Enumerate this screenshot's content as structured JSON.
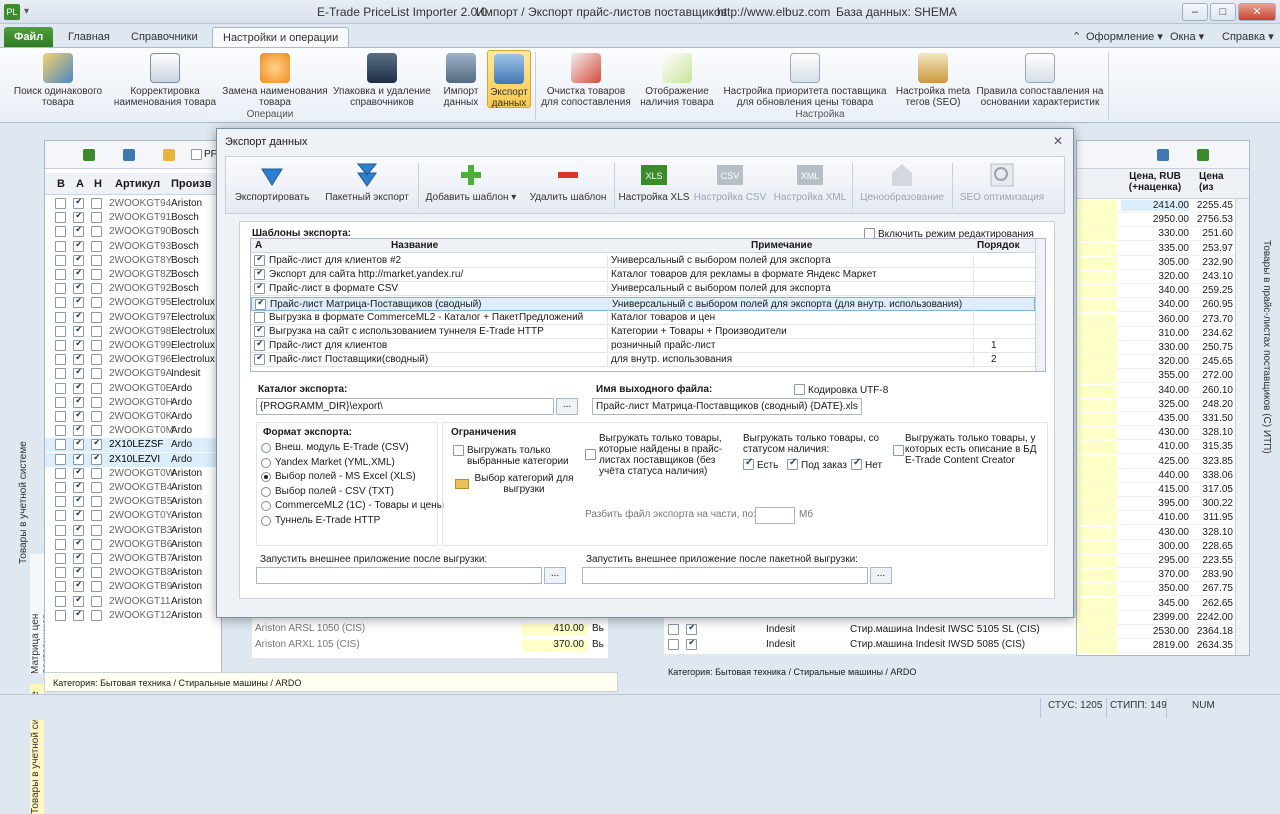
{
  "window": {
    "title": "E-Trade PriceList Importer 2.0.0",
    "subtitle": "Импорт / Экспорт прайс-листов поставщиков",
    "url": "http://www.elbuz.com",
    "db": "База данных: SHEMA"
  },
  "tabs": [
    "Файл",
    "Главная",
    "Справочники",
    "Настройки и операции"
  ],
  "right_menu": [
    "Оформление",
    "Окна",
    "Справка"
  ],
  "ribbon": {
    "buttons": [
      {
        "label": "Поиск одинакового товара"
      },
      {
        "label": "Корректировка наименования товара"
      },
      {
        "label": "Замена наименования товара"
      },
      {
        "label": "Упаковка и удаление справочников"
      },
      {
        "label": "Импорт данных"
      },
      {
        "label": "Экспорт данных"
      },
      {
        "label": "Очистка товаров для сопоставления"
      },
      {
        "label": "Отображение наличия товара"
      },
      {
        "label": "Настройка приоритета поставщика для обновления цены товара"
      },
      {
        "label": "Настройка meta тегов (SEO)"
      },
      {
        "label": "Правила сопоставления на основании характеристик"
      }
    ],
    "groups": [
      "Операции",
      "Настройка"
    ]
  },
  "left_grid": {
    "headers": [
      "В",
      "А",
      "Н",
      "Артикул",
      "Произв"
    ],
    "rows": [
      {
        "art": "2WOOKGT94",
        "brand": "Ariston",
        "a": true,
        "h": false
      },
      {
        "art": "2WOOKGT91",
        "brand": "Bosch",
        "a": true,
        "h": false
      },
      {
        "art": "2WOOKGT90",
        "brand": "Bosch",
        "a": true,
        "h": false
      },
      {
        "art": "2WOOKGT93",
        "brand": "Bosch",
        "a": true,
        "h": false
      },
      {
        "art": "2WOOKGT8Y",
        "brand": "Bosch",
        "a": true,
        "h": false
      },
      {
        "art": "2WOOKGT8Z",
        "brand": "Bosch",
        "a": true,
        "h": false
      },
      {
        "art": "2WOOKGT92",
        "brand": "Bosch",
        "a": true,
        "h": false
      },
      {
        "art": "2WOOKGT95",
        "brand": "Electrolux",
        "a": true,
        "h": false
      },
      {
        "art": "2WOOKGT97",
        "brand": "Electrolux",
        "a": true,
        "h": false
      },
      {
        "art": "2WOOKGT98",
        "brand": "Electrolux",
        "a": true,
        "h": false
      },
      {
        "art": "2WOOKGT99",
        "brand": "Electrolux",
        "a": true,
        "h": false
      },
      {
        "art": "2WOOKGT96",
        "brand": "Electrolux",
        "a": true,
        "h": false
      },
      {
        "art": "2WOOKGT9A",
        "brand": "Indesit",
        "a": true,
        "h": false
      },
      {
        "art": "2WOOKGT0E",
        "brand": "Ardo",
        "a": true,
        "h": false
      },
      {
        "art": "2WOOKGT0H",
        "brand": "Ardo",
        "a": true,
        "h": false
      },
      {
        "art": "2WOOKGT0K",
        "brand": "Ardo",
        "a": true,
        "h": false
      },
      {
        "art": "2WOOKGT0M",
        "brand": "Ardo",
        "a": true,
        "h": false
      },
      {
        "art": "2X10LEZSF",
        "brand": "Ardo",
        "a": true,
        "h": true
      },
      {
        "art": "2X10LEZVI",
        "brand": "Ardo",
        "a": true,
        "h": true
      },
      {
        "art": "2WOOKGT0W",
        "brand": "Ariston",
        "a": true,
        "h": false
      },
      {
        "art": "2WOOKGTB4",
        "brand": "Ariston",
        "a": true,
        "h": false
      },
      {
        "art": "2WOOKGTB5",
        "brand": "Ariston",
        "a": true,
        "h": false
      },
      {
        "art": "2WOOKGT0Y",
        "brand": "Ariston",
        "a": true,
        "h": false
      },
      {
        "art": "2WOOKGTB3",
        "brand": "Ariston",
        "a": true,
        "h": false
      },
      {
        "art": "2WOOKGTB6",
        "brand": "Ariston",
        "a": true,
        "h": false
      },
      {
        "art": "2WOOKGTB7",
        "brand": "Ariston",
        "a": true,
        "h": false
      },
      {
        "art": "2WOOKGTB8",
        "brand": "Ariston",
        "a": true,
        "h": false
      },
      {
        "art": "2WOOKGTB9",
        "brand": "Ariston",
        "a": true,
        "h": false
      },
      {
        "art": "2WOOKGT11",
        "brand": "Ariston",
        "a": true,
        "h": false
      },
      {
        "art": "2WOOKGT12",
        "brand": "Ariston",
        "a": true,
        "h": false
      }
    ],
    "peek_rows": [
      {
        "name": "Ariston ARSL 1050 (CIS)",
        "price": "410.00",
        "extra": "Вь"
      },
      {
        "name": "Ariston ARXL 105 (CIS)",
        "price": "370.00",
        "extra": "Вь"
      }
    ],
    "category": "Категория: Бытовая техника / Стиральные машины / ARDO",
    "vtabs": [
      "Товары в учетной системе",
      "Матрица цен поставщиков",
      "Товары в учетной системе"
    ],
    "pr_label": "PF"
  },
  "right_grid": {
    "headers": [
      "Цена, RUB (+наценка)",
      "Цена (из"
    ],
    "rows": [
      [
        "2414.00",
        "2255.45"
      ],
      [
        "2950.00",
        "2756.53"
      ],
      [
        "330.00",
        "251.60"
      ],
      [
        "335.00",
        "253.97"
      ],
      [
        "305.00",
        "232.90"
      ],
      [
        "320.00",
        "243.10"
      ],
      [
        "340.00",
        "259.25"
      ],
      [
        "340.00",
        "260.95"
      ],
      [
        "360.00",
        "273.70"
      ],
      [
        "310.00",
        "234.62"
      ],
      [
        "330.00",
        "250.75"
      ],
      [
        "320.00",
        "245.65"
      ],
      [
        "355.00",
        "272.00"
      ],
      [
        "340.00",
        "260.10"
      ],
      [
        "325.00",
        "248.20"
      ],
      [
        "435.00",
        "331.50"
      ],
      [
        "430.00",
        "328.10"
      ],
      [
        "410.00",
        "315.35"
      ],
      [
        "425.00",
        "323.85"
      ],
      [
        "440.00",
        "338.06"
      ],
      [
        "415.00",
        "317.05"
      ],
      [
        "395.00",
        "300.22"
      ],
      [
        "410.00",
        "311.95"
      ],
      [
        "430.00",
        "328.10"
      ],
      [
        "300.00",
        "228.65"
      ],
      [
        "295.00",
        "223.55"
      ],
      [
        "370.00",
        "283.90"
      ],
      [
        "350.00",
        "267.75"
      ],
      [
        "345.00",
        "262.65"
      ],
      [
        "2399.00",
        "2242.00"
      ],
      [
        "2530.00",
        "2364.18"
      ],
      [
        "2819.00",
        "2634.35"
      ]
    ],
    "bottom_rows": [
      {
        "brand": "Indesit",
        "name": "Стир.машина Indesit IWSC 5105 SL (CIS)"
      },
      {
        "brand": "Indesit",
        "name": "Стир.машина Indesit IWSD 5085 (CIS)"
      }
    ],
    "category": "Категория: Бытовая техника / Стиральные машины / ARDO",
    "vtab": "Товары в прайс-листах поставщиков (С) ИТП)"
  },
  "dialog": {
    "title": "Экспорт данных",
    "toolbar": [
      {
        "label": "Экспортировать",
        "enabled": true
      },
      {
        "label": "Пакетный экспорт",
        "enabled": true
      },
      {
        "label": "Добавить шаблон",
        "enabled": true
      },
      {
        "label": "Удалить шаблон",
        "enabled": true
      },
      {
        "label": "Настройка XLS",
        "enabled": true
      },
      {
        "label": "Настройка CSV",
        "enabled": false
      },
      {
        "label": "Настройка XML",
        "enabled": false
      },
      {
        "label": "Ценообразование",
        "enabled": false
      },
      {
        "label": "SEO оптимизация",
        "enabled": false
      }
    ],
    "templates_label": "Шаблоны экспорта:",
    "edit_mode_label": "Включить режим редактирования",
    "table_headers": [
      "А",
      "Название",
      "Примечание",
      "Порядок"
    ],
    "templates": [
      {
        "on": true,
        "name": "Прайс-лист для клиентов #2",
        "note": "Универсальный с выбором полей для экспорта",
        "order": ""
      },
      {
        "on": true,
        "name": "Экспорт для сайта http://market.yandex.ru/",
        "note": "Каталог товаров для рекламы в формате Яндекс Маркет",
        "order": ""
      },
      {
        "on": true,
        "name": "Прайс-лист в формате CSV",
        "note": "Универсальный с выбором полей для экспорта",
        "order": ""
      },
      {
        "on": true,
        "name": "Прайс-лист Матрица-Поставщиков (сводный)",
        "note": "Универсальный с выбором полей для экспорта (для внутр. использования)",
        "order": ""
      },
      {
        "on": false,
        "name": "Выгрузка в формате CommerceML2 - Каталог + ПакетПредложений",
        "note": "Каталог товаров и цен",
        "order": ""
      },
      {
        "on": true,
        "name": "Выгрузка на сайт с использованием туннеля E-Trade HTTP",
        "note": "Категории + Товары + Производители",
        "order": ""
      },
      {
        "on": true,
        "name": "Прайс-лист для клиентов",
        "note": "розничный прайс-лист",
        "order": "1"
      },
      {
        "on": true,
        "name": "Прайс-лист Поставщики(сводный)",
        "note": "для внутр. использования",
        "order": "2"
      }
    ],
    "catalog_label": "Каталог экспорта:",
    "catalog_value": "{PROGRAMM_DIR}\\export\\",
    "filename_label": "Имя выходного файла:",
    "utf8_label": "Кодировка UTF-8",
    "filename_value": "Прайс-лист Матрица-Поставщиков (сводный) {DATE}.xls",
    "format_label": "Формат экспорта:",
    "formats": [
      {
        "label": "Внеш. модуль E-Trade (CSV)",
        "on": false
      },
      {
        "label": "Yandex Market (YML,XML)",
        "on": false
      },
      {
        "label": "Выбор полей - MS Excel (XLS)",
        "on": true
      },
      {
        "label": "Выбор полей - CSV (TXT)",
        "on": false
      },
      {
        "label": "CommerceML2 (1С) - Товары и цены",
        "on": false
      },
      {
        "label": "Туннель E-Trade HTTP",
        "on": false
      }
    ],
    "limits_label": "Ограничения",
    "limit_selected_cats": "Выгружать только выбранные категории",
    "choose_cats": "Выбор категорий для выгрузки",
    "limit_found": "Выгружать только товары, которые найдены в прайс-листах поставщиков (без учёта статуса наличия)",
    "limit_status": "Выгружать только товары, со статусом наличия:",
    "status_opts": [
      {
        "label": "Есть",
        "on": true
      },
      {
        "label": "Под заказ",
        "on": true
      },
      {
        "label": "Нет",
        "on": true
      }
    ],
    "limit_desc": "Выгружать только товары, у которых есть описание в БД E-Trade Content Creator",
    "split_label": "Разбить файл экспорта на части, по:",
    "split_unit": "Мб",
    "run_after_label": "Запустить внешнее приложение после выгрузки:",
    "run_after_batch_label": "Запустить внешнее приложение после пакетной выгрузки:",
    "ellipsis": "..."
  },
  "status": {
    "stus": "СТУС: 1205",
    "stipp": "СТИПП: 149",
    "num": "NUM"
  },
  "colors": {
    "accent": "#f8c94e",
    "file_tab": "#3b8a2b",
    "selection": "#dceefc"
  }
}
